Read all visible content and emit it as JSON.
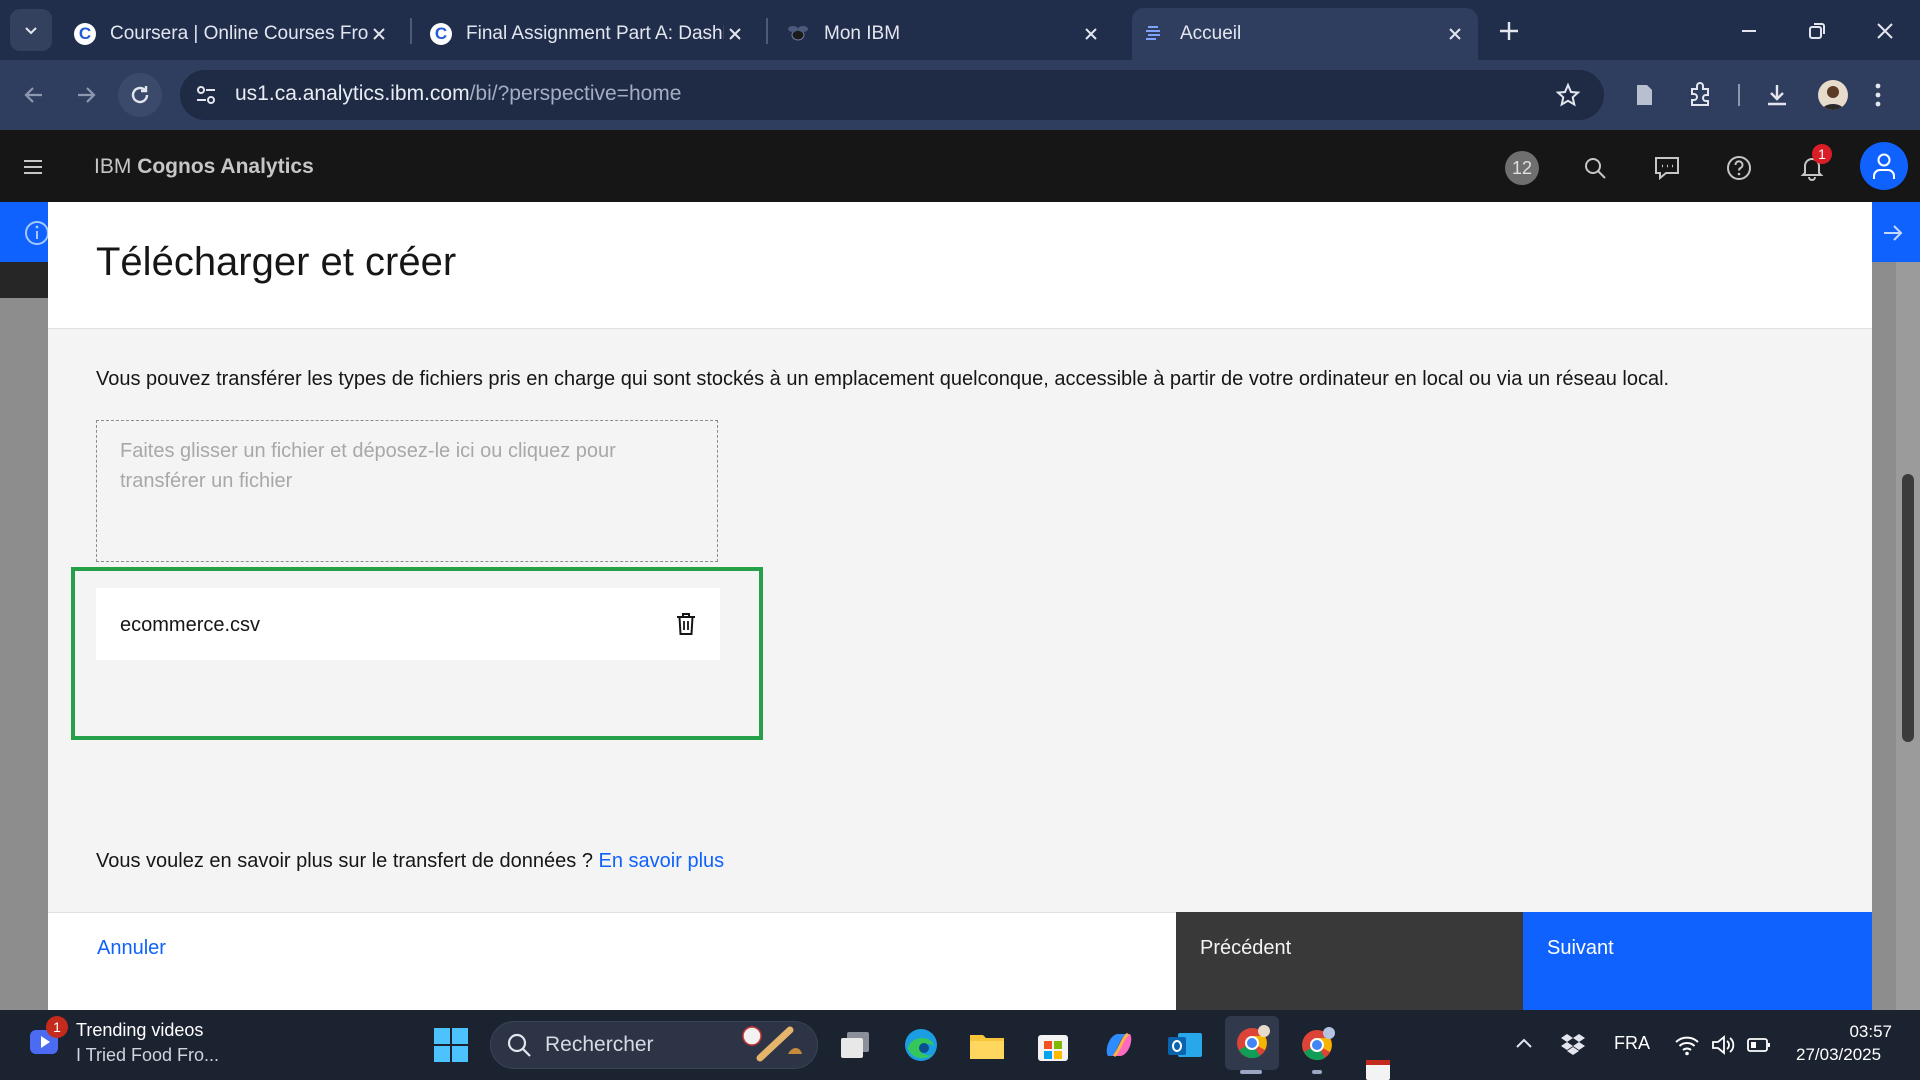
{
  "browser": {
    "tabs": [
      {
        "title": "Coursera | Online Courses From",
        "favicon": "coursera-c"
      },
      {
        "title": "Final Assignment Part A: Dashbo",
        "favicon": "coursera-c"
      },
      {
        "title": "Mon IBM",
        "favicon": "ibm-bee"
      },
      {
        "title": "Accueil",
        "favicon": "cognos-lines",
        "active": true
      }
    ],
    "url_host": "us1.ca.analytics.ibm.com",
    "url_path": "/bi/?perspective=home"
  },
  "app": {
    "brand_prefix": "IBM",
    "brand_name": "Cognos Analytics",
    "badge_count": "12",
    "notification_count": "1"
  },
  "modal": {
    "title": "Télécharger et créer",
    "description": "Vous pouvez transférer les types de fichiers pris en charge qui sont stockés à un emplacement quelconque, accessible à partir de votre ordinateur en local ou via un réseau local.",
    "dropzone_text": "Faites glisser un fichier et déposez-le ici ou cliquez pour transférer un fichier",
    "file_name": "ecommerce.csv",
    "learn_more_prefix": "Vous voulez en savoir plus sur le transfert de données ?",
    "learn_more_link": "En savoir plus",
    "cancel_label": "Annuler",
    "previous_label": "Précédent",
    "next_label": "Suivant"
  },
  "taskbar": {
    "news_badge": "1",
    "news_title": "Trending videos",
    "news_subtitle": "I Tried Food Fro...",
    "search_placeholder": "Rechercher",
    "language": "FRA",
    "time": "03:57",
    "date": "27/03/2025"
  },
  "colors": {
    "ibm_blue": "#0f62fe",
    "highlight_green": "#24a148",
    "tabstrip": "#202d4b"
  }
}
